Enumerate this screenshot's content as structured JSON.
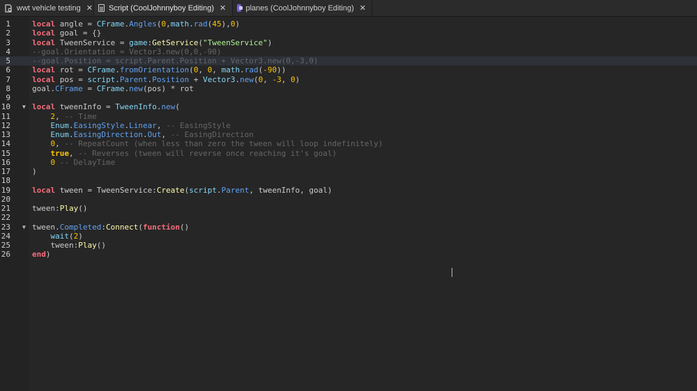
{
  "tabs": [
    {
      "label": "wwt vehicle testing",
      "icon": "script-icon",
      "close": "✕"
    },
    {
      "label": "Script (CoolJohnnyboy Editing)",
      "icon": "document-icon",
      "close": "✕"
    },
    {
      "label": "planes (CoolJohnnyboy Editing)",
      "icon": "module-script-icon",
      "close": "✕"
    }
  ],
  "colors": {
    "keyword": "#f86d7c",
    "builtin": "#84d6f7",
    "method": "#fdfbac",
    "number": "#ffc600",
    "string": "#adf195",
    "comment": "#666666",
    "text": "#cccccc",
    "property": "#61a1f1",
    "bool": "#ffc600"
  },
  "lines": [
    {
      "n": "1",
      "fold": "",
      "tokens": [
        [
          "keyword",
          "local"
        ],
        [
          "text",
          " angle = "
        ],
        [
          "builtin",
          "CFrame"
        ],
        [
          "text",
          "."
        ],
        [
          "property",
          "Angles"
        ],
        [
          "text",
          "("
        ],
        [
          "number",
          "0"
        ],
        [
          "text",
          ","
        ],
        [
          "builtin",
          "math"
        ],
        [
          "text",
          "."
        ],
        [
          "property",
          "rad"
        ],
        [
          "text",
          "("
        ],
        [
          "number",
          "45"
        ],
        [
          "text",
          "),"
        ],
        [
          "number",
          "0"
        ],
        [
          "text",
          ")"
        ]
      ]
    },
    {
      "n": "2",
      "fold": "",
      "tokens": [
        [
          "keyword",
          "local"
        ],
        [
          "text",
          " goal = {}"
        ]
      ]
    },
    {
      "n": "3",
      "fold": "",
      "tokens": [
        [
          "keyword",
          "local"
        ],
        [
          "text",
          " TweenService = "
        ],
        [
          "builtin",
          "game"
        ],
        [
          "text",
          ":"
        ],
        [
          "method",
          "GetService"
        ],
        [
          "text",
          "("
        ],
        [
          "string",
          "\"TweenService\""
        ],
        [
          "text",
          ")"
        ]
      ]
    },
    {
      "n": "4",
      "fold": "",
      "tokens": [
        [
          "comment",
          "--goal.Orientation = Vector3.new(0,0,-90)"
        ]
      ]
    },
    {
      "n": "5",
      "fold": "",
      "highlight": true,
      "tokens": [
        [
          "comment",
          "--goal.Position = script.Parent.Position + Vector3.new(0,-3,0)"
        ]
      ]
    },
    {
      "n": "6",
      "fold": "",
      "tokens": [
        [
          "keyword",
          "local"
        ],
        [
          "text",
          " rot = "
        ],
        [
          "builtin",
          "CFrame"
        ],
        [
          "text",
          "."
        ],
        [
          "property",
          "fromOrientation"
        ],
        [
          "text",
          "("
        ],
        [
          "number",
          "0"
        ],
        [
          "text",
          ", "
        ],
        [
          "number",
          "0"
        ],
        [
          "text",
          ", "
        ],
        [
          "builtin",
          "math"
        ],
        [
          "text",
          "."
        ],
        [
          "property",
          "rad"
        ],
        [
          "text",
          "("
        ],
        [
          "number",
          "-90"
        ],
        [
          "text",
          "))"
        ]
      ]
    },
    {
      "n": "7",
      "fold": "",
      "tokens": [
        [
          "keyword",
          "local"
        ],
        [
          "text",
          " pos = "
        ],
        [
          "builtin",
          "script"
        ],
        [
          "text",
          "."
        ],
        [
          "property",
          "Parent"
        ],
        [
          "text",
          "."
        ],
        [
          "property",
          "Position"
        ],
        [
          "text",
          " + "
        ],
        [
          "builtin",
          "Vector3"
        ],
        [
          "text",
          "."
        ],
        [
          "property",
          "new"
        ],
        [
          "text",
          "("
        ],
        [
          "number",
          "0"
        ],
        [
          "text",
          ", "
        ],
        [
          "number",
          "-3"
        ],
        [
          "text",
          ", "
        ],
        [
          "number",
          "0"
        ],
        [
          "text",
          ")"
        ]
      ]
    },
    {
      "n": "8",
      "fold": "",
      "tokens": [
        [
          "text",
          "goal."
        ],
        [
          "property",
          "CFrame"
        ],
        [
          "text",
          " = "
        ],
        [
          "builtin",
          "CFrame"
        ],
        [
          "text",
          "."
        ],
        [
          "property",
          "new"
        ],
        [
          "text",
          "(pos) * rot"
        ]
      ]
    },
    {
      "n": "9",
      "fold": "",
      "tokens": []
    },
    {
      "n": "10",
      "fold": "▼",
      "tokens": [
        [
          "keyword",
          "local"
        ],
        [
          "text",
          " tweenInfo = "
        ],
        [
          "builtin",
          "TweenInfo"
        ],
        [
          "text",
          "."
        ],
        [
          "property",
          "new"
        ],
        [
          "text",
          "("
        ]
      ]
    },
    {
      "n": "11",
      "fold": "",
      "tokens": [
        [
          "text",
          "    "
        ],
        [
          "number",
          "2"
        ],
        [
          "text",
          ", "
        ],
        [
          "comment",
          "-- Time"
        ]
      ]
    },
    {
      "n": "12",
      "fold": "",
      "tokens": [
        [
          "text",
          "    "
        ],
        [
          "builtin",
          "Enum"
        ],
        [
          "text",
          "."
        ],
        [
          "property",
          "EasingStyle"
        ],
        [
          "text",
          "."
        ],
        [
          "property",
          "Linear"
        ],
        [
          "text",
          ", "
        ],
        [
          "comment",
          "-- EasingStyle"
        ]
      ]
    },
    {
      "n": "13",
      "fold": "",
      "tokens": [
        [
          "text",
          "    "
        ],
        [
          "builtin",
          "Enum"
        ],
        [
          "text",
          "."
        ],
        [
          "property",
          "EasingDirection"
        ],
        [
          "text",
          "."
        ],
        [
          "property",
          "Out"
        ],
        [
          "text",
          ", "
        ],
        [
          "comment",
          "-- EasingDirection"
        ]
      ]
    },
    {
      "n": "14",
      "fold": "",
      "tokens": [
        [
          "text",
          "    "
        ],
        [
          "number",
          "0"
        ],
        [
          "text",
          ", "
        ],
        [
          "comment",
          "-- RepeatCount (when less than zero the tween will loop indefinitely)"
        ]
      ]
    },
    {
      "n": "15",
      "fold": "",
      "tokens": [
        [
          "text",
          "    "
        ],
        [
          "bool",
          "true"
        ],
        [
          "text",
          ", "
        ],
        [
          "comment",
          "-- Reverses (tween will reverse once reaching it's goal)"
        ]
      ]
    },
    {
      "n": "16",
      "fold": "",
      "tokens": [
        [
          "text",
          "    "
        ],
        [
          "number",
          "0"
        ],
        [
          "text",
          " "
        ],
        [
          "comment",
          "-- DelayTime"
        ]
      ]
    },
    {
      "n": "17",
      "fold": "",
      "tokens": [
        [
          "text",
          ")"
        ]
      ]
    },
    {
      "n": "18",
      "fold": "",
      "tokens": []
    },
    {
      "n": "19",
      "fold": "",
      "tokens": [
        [
          "keyword",
          "local"
        ],
        [
          "text",
          " tween = TweenService:"
        ],
        [
          "method",
          "Create"
        ],
        [
          "text",
          "("
        ],
        [
          "builtin",
          "script"
        ],
        [
          "text",
          "."
        ],
        [
          "property",
          "Parent"
        ],
        [
          "text",
          ", tweenInfo, goal)"
        ]
      ]
    },
    {
      "n": "20",
      "fold": "",
      "tokens": []
    },
    {
      "n": "21",
      "fold": "",
      "tokens": [
        [
          "text",
          "tween:"
        ],
        [
          "method",
          "Play"
        ],
        [
          "text",
          "()"
        ]
      ]
    },
    {
      "n": "22",
      "fold": "",
      "tokens": []
    },
    {
      "n": "23",
      "fold": "▼",
      "tokens": [
        [
          "text",
          "tween."
        ],
        [
          "property",
          "Completed"
        ],
        [
          "text",
          ":"
        ],
        [
          "method",
          "Connect"
        ],
        [
          "text",
          "("
        ],
        [
          "keyword",
          "function"
        ],
        [
          "text",
          "()"
        ]
      ]
    },
    {
      "n": "24",
      "fold": "",
      "tokens": [
        [
          "text",
          "    "
        ],
        [
          "builtin",
          "wait"
        ],
        [
          "text",
          "("
        ],
        [
          "number",
          "2"
        ],
        [
          "text",
          ")"
        ]
      ]
    },
    {
      "n": "25",
      "fold": "",
      "tokens": [
        [
          "text",
          "    tween:"
        ],
        [
          "method",
          "Play"
        ],
        [
          "text",
          "()"
        ]
      ]
    },
    {
      "n": "26",
      "fold": "",
      "tokens": [
        [
          "keyword",
          "end"
        ],
        [
          "text",
          ")"
        ]
      ]
    }
  ]
}
